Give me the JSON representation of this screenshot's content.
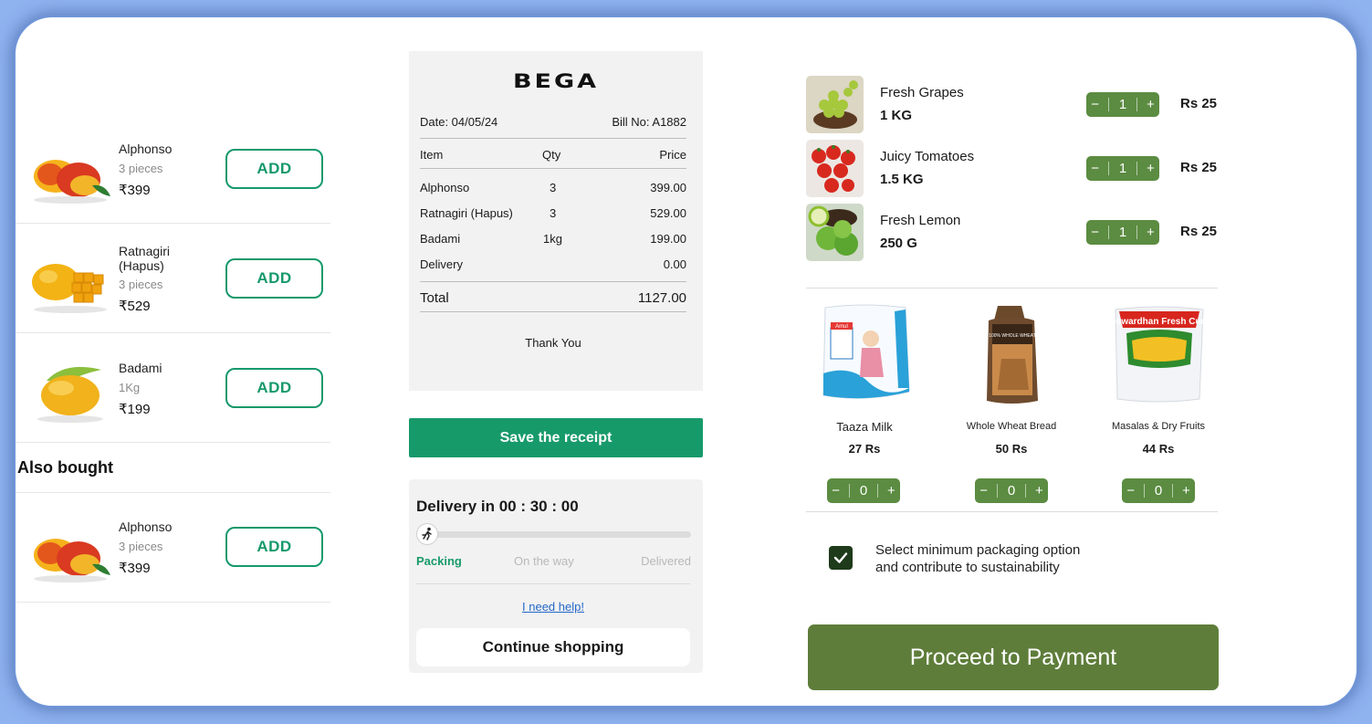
{
  "products": [
    {
      "name": "Alphonso",
      "qty": "3 pieces",
      "price": "₹399",
      "button": "ADD",
      "icon": "alphonso-mango-image"
    },
    {
      "name": "Ratnagiri (Hapus)",
      "qty": "3 pieces",
      "price": "₹529",
      "button": "ADD",
      "icon": "ratnagiri-mango-image"
    },
    {
      "name": "Badami",
      "qty": "1Kg",
      "price": "₹199",
      "button": "ADD",
      "icon": "badami-mango-image"
    }
  ],
  "also_bought": {
    "title": "Also bought",
    "items": [
      {
        "name": "Alphonso",
        "qty": "3 pieces",
        "price": "₹399",
        "button": "ADD"
      }
    ]
  },
  "receipt": {
    "brand": "BEGA",
    "date": "Date: 04/05/24",
    "bill": "Bill No: A1882",
    "headers": {
      "item": "Item",
      "qty": "Qty",
      "price": "Price"
    },
    "rows": [
      {
        "item": "Alphonso",
        "qty": "3",
        "price": "399.00"
      },
      {
        "item": "Ratnagiri (Hapus)",
        "qty": "3",
        "price": "529.00"
      },
      {
        "item": "Badami",
        "qty": "1kg",
        "price": "199.00"
      },
      {
        "item": "Delivery",
        "qty": "",
        "price": "0.00"
      }
    ],
    "total_label": "Total",
    "total_value": "1127.00",
    "thanks": "Thank You",
    "save_button": "Save the receipt"
  },
  "delivery": {
    "title": "Delivery in 00 : 30 : 00",
    "progress": 0.04,
    "steps": [
      "Packing",
      "On the way",
      "Delivered"
    ],
    "active_step": 0,
    "help_link": "I need help!",
    "continue_button": "Continue shopping"
  },
  "cart": [
    {
      "name": "Fresh Grapes",
      "weight": "1 KG",
      "count": "1",
      "price": "Rs 25",
      "icon": "grapes-image"
    },
    {
      "name": "Juicy Tomatoes",
      "weight": "1.5 KG",
      "count": "1",
      "price": "Rs 25",
      "icon": "tomatoes-image"
    },
    {
      "name": "Fresh Lemon",
      "weight": "250 G",
      "count": "1",
      "price": "Rs 25",
      "icon": "lemon-image"
    }
  ],
  "stepper_symbols": {
    "minus": "−",
    "plus": "+"
  },
  "suggestions": [
    {
      "name": "Taaza Milk",
      "price": "27 Rs",
      "count": "0",
      "icon": "milk-pack-image",
      "brand_text": "Amul"
    },
    {
      "name": "Whole Wheat Bread",
      "price": "50 Rs",
      "count": "0",
      "icon": "bread-image",
      "brand_text": "100% WHOLE WHEAT"
    },
    {
      "name": "Masalas & Dry Fruits",
      "price": "44 Rs",
      "count": "0",
      "icon": "curd-pack-image",
      "brand_text": "Gowardhan Fresh Curd"
    }
  ],
  "packaging": {
    "checked": true,
    "line1": "Select minimum packaging option",
    "line2": "and contribute to sustainability"
  },
  "payment_button": "Proceed to Payment",
  "colors": {
    "accent_green": "#179a6a",
    "stepper_green": "#5b8c41",
    "pay_green": "#5e7d3a",
    "page_bg": "#8fb3ef",
    "link_blue": "#2467c7"
  }
}
